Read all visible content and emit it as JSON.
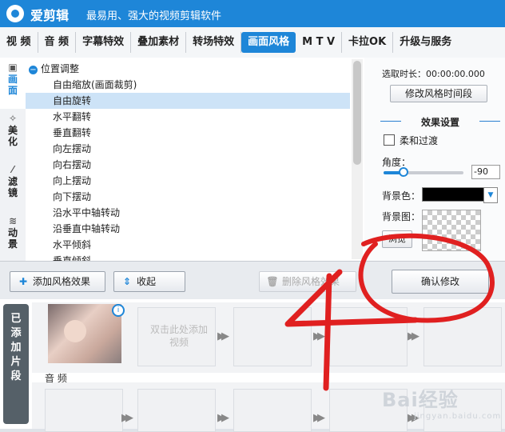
{
  "app": {
    "name": "爱剪辑",
    "slogan": "最易用、强大的视频剪辑软件"
  },
  "tabs": [
    "视 频",
    "音 频",
    "字幕特效",
    "叠加素材",
    "转场特效",
    "画面风格",
    "M T V",
    "卡拉OK",
    "升级与服务"
  ],
  "active_tab": "画面风格",
  "side_tabs": [
    {
      "icon": "image-icon",
      "label": "画面"
    },
    {
      "icon": "magic-wand-icon",
      "label": "美化"
    },
    {
      "icon": "wand-icon",
      "label": "滤镜"
    },
    {
      "icon": "waves-icon",
      "label": "动景"
    }
  ],
  "effect_list": {
    "group": "位置调整",
    "items": [
      "自由缩放(画面裁剪)",
      "自由旋转",
      "水平翻转",
      "垂直翻转",
      "向左摆动",
      "向右摆动",
      "向上摆动",
      "向下摆动",
      "沿水平中轴转动",
      "沿垂直中轴转动",
      "水平倾斜",
      "垂直倾斜"
    ],
    "selected": "自由旋转"
  },
  "settings": {
    "duration_label": "选取时长：",
    "duration_value": "00:00:00.000",
    "modify_time_button": "修改风格时间段",
    "section_title": "效果设置",
    "smooth_transition": "柔和过渡",
    "smooth_checked": false,
    "angle_label": "角度：",
    "angle_value": "-90",
    "angle_fraction": 0.25,
    "bg_color_label": "背景色：",
    "bg_color": "#000000",
    "bg_image_label": "背景图：",
    "browse_button": "浏览"
  },
  "toolbar": {
    "add_style": "添加风格效果",
    "collapse": "收起",
    "delete_style": "删除风格效果",
    "confirm": "确认修改"
  },
  "timeline": {
    "side_label": "已添加片段",
    "click_hint": "双击此处添加视频",
    "audio_label": "音 频"
  },
  "annotation": {
    "text": "4",
    "color": "#e02020"
  },
  "watermark": {
    "text": "Bai经验",
    "sub": "jingyan.baidu.com"
  }
}
